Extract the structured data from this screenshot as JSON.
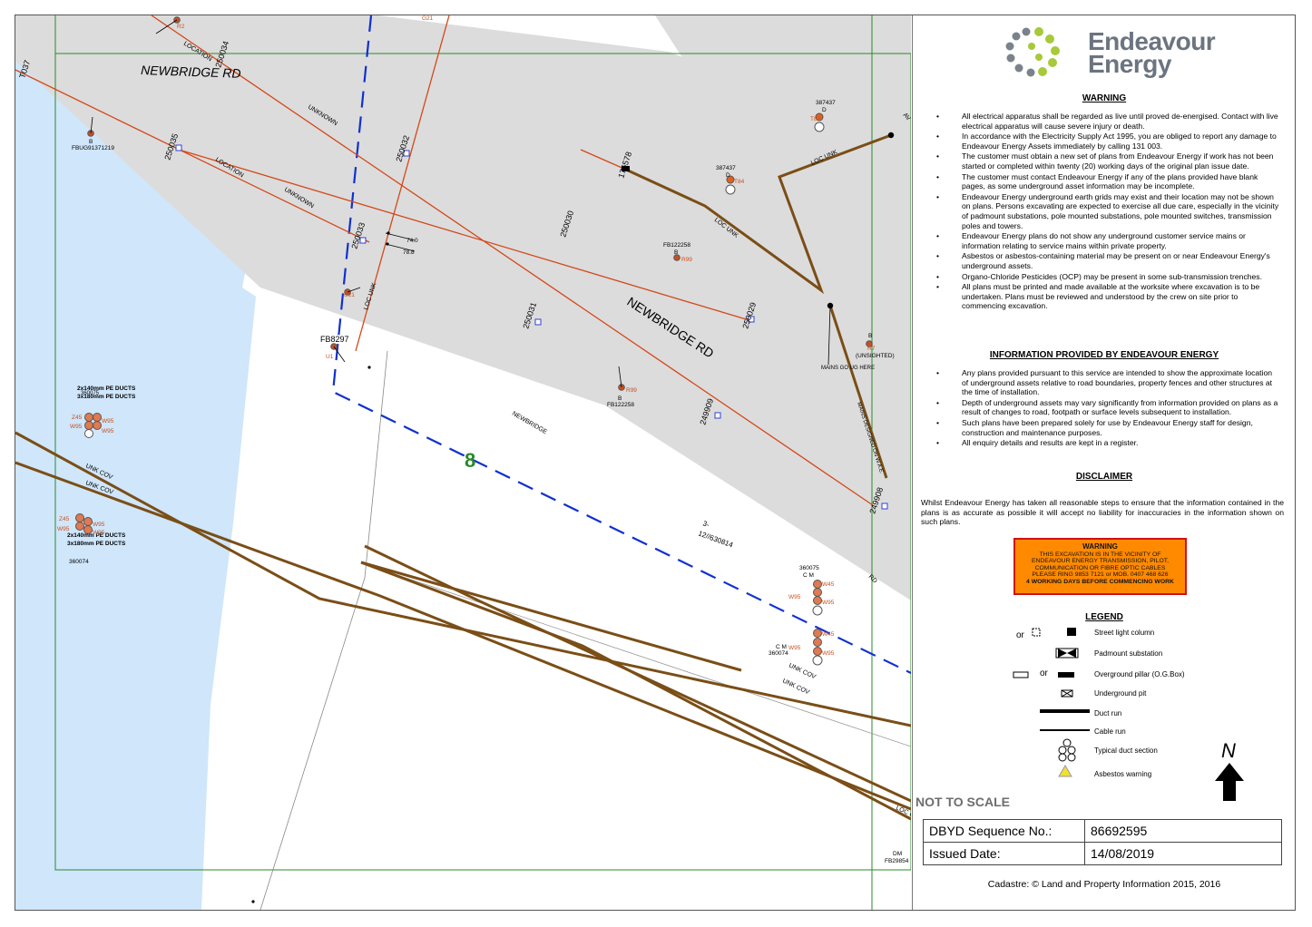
{
  "map": {
    "roads": {
      "road_top": "NEWBRIDGE RD",
      "road_main": "NEWBRIDGE RD",
      "road_lower": "NEWBRIDGE",
      "road_right": "AV",
      "road_rd": "RD"
    },
    "location_labels": {
      "loc1": "LOCATION",
      "loc2": "UNKNOWN",
      "loc3": "LOCATION",
      "loc4": "UNKNOWN",
      "loc5": "LOC UNK",
      "loc6": "LOC UNK",
      "loc7": "LOC UNK",
      "loc8": "MAINS DESIGNED ON W.A.E.",
      "loc9": "MAINS GO UG HERE",
      "loc10": "(UNSIGHTED)",
      "unk1": "UNK COV",
      "unk2": "UNK COV",
      "unk3": "UNK COV",
      "unk4": "UNK COV",
      "loc11": "LOC UNK"
    },
    "pole_numbers": [
      "250035",
      "250034",
      "250032",
      "250033",
      "250030",
      "176578",
      "250031",
      "250029",
      "249909",
      "249908",
      "T037"
    ],
    "asset_ids": {
      "fbug": "FBUG91371219",
      "fb122258a": "FB122258",
      "fb122258b": "FB122258",
      "fb8297": "FB8297",
      "a387437a": "387437",
      "a387437b": "387437",
      "a360075": "360075",
      "a360074a": "360074",
      "a360074b": "360074",
      "fb29854": "FB29854",
      "dm": "DM"
    },
    "pole_codes": [
      "R2",
      "G21",
      "T81",
      "T84",
      "R99",
      "R99",
      "U21",
      "U1",
      "R7",
      "B",
      "B",
      "D",
      "D",
      "B",
      "B"
    ],
    "duct_labels": {
      "d1": "2x140mm PE DUCTS",
      "d2": "3x180mm PE DUCTS",
      "d3": "2x140mm PE DUCTS",
      "d4": "3x180mm PE DUCTS",
      "d5": "360075"
    },
    "duct_codes": [
      "Z45",
      "W95",
      "W95",
      "W95",
      "Z45",
      "W95",
      "W95",
      "W95",
      "W45",
      "W95",
      "W95",
      "W45",
      "W95",
      "W95",
      "C M",
      "C M"
    ],
    "measurements": [
      "74.0",
      "78.8"
    ],
    "sheet_number": "8",
    "lot": "3-",
    "lot_dp": "12//630814",
    "colors": {
      "road": "#dcdcdc",
      "water": "#cfe6fb",
      "cable": "#d4481a",
      "duct": "#7a4e16",
      "boundary": "#2a8a2a",
      "dash": "#1030d0"
    }
  },
  "panel": {
    "logo_line1": "Endeavour",
    "logo_line2": "Energy",
    "warning_title": "WARNING",
    "warnings": [
      "All electrical apparatus shall be regarded as live until proved de-energised. Contact with live electrical apparatus will cause severe injury or death.",
      "In accordance with the Electricity Supply Act 1995, you are obliged to report any damage to Endeavour Energy Assets immediately by calling 131 003.",
      "The customer must obtain a new set of plans from Endeavour Energy if work has not been started or completed within twenty (20) working days of the original plan issue date.",
      "The customer must contact Endeavour Energy if any of the plans provided have blank pages, as some underground asset information may be incomplete.",
      "Endeavour Energy underground earth grids may exist and their location may not be shown on plans. Persons excavating are expected to exercise all due care, especially in the vicinity of padmount substations, pole mounted substations, pole mounted switches, transmission poles and towers.",
      "Endeavour Energy plans do not show any underground customer service mains or information relating to service mains within private property.",
      "Asbestos or asbestos-containing material may be present on or near Endeavour Energy's underground assets.",
      "Organo-Chloride Pesticides (OCP) may be present in some sub-transmission trenches.",
      "All plans must be printed and made available at the worksite where excavation is to be undertaken. Plans must be reviewed and understood by the crew on site prior to commencing excavation."
    ],
    "info_title": "INFORMATION PROVIDED BY ENDEAVOUR ENERGY",
    "info_items": [
      "Any plans provided pursuant to this service are intended to show the approximate location of underground assets relative to road boundaries, property fences and other structures at the time of installation.",
      "Depth of underground assets may vary significantly from information provided on plans as a result of changes to road, footpath or surface levels subsequent to installation.",
      "Such plans have been prepared solely for use by Endeavour Energy staff for design, construction and maintenance purposes.",
      "All enquiry details and results are kept in a register."
    ],
    "disclaimer_title": "DISCLAIMER",
    "disclaimer": "Whilst Endeavour Energy has taken all reasonable steps to ensure that the information contained in the plans is as accurate as possible it will accept no liability for inaccuracies in the information shown on such plans.",
    "warnbox": {
      "title": "WARNING",
      "line1": "THIS EXCAVATION IS IN THE VICINITY OF",
      "line2": "ENDEAVOUR ENERGY TRANSMISSION, PILOT,",
      "line3": "COMMUNICATION OR FIBRE OPTIC CABLES",
      "line4": "PLEASE RING 9853 7121 or MOB. 0407 468 626",
      "line5": "4 WORKING DAYS BEFORE COMMENCING WORK"
    },
    "legend_title": "LEGEND",
    "legend": {
      "or1": "or",
      "or2": "or",
      "street_light": "Street light column",
      "padmount": "Padmount substation",
      "pillar": "Overground pillar (O.G.Box)",
      "pit": "Underground pit",
      "duct_run": "Duct run",
      "cable_run": "Cable run",
      "duct_section": "Typical duct section",
      "asbestos": "Asbestos warning"
    },
    "north": "N",
    "not_to_scale": "NOT TO SCALE",
    "seq_label": "DBYD Sequence No.:",
    "seq_value": "86692595",
    "date_label": "Issued Date:",
    "date_value": "14/08/2019",
    "cadastre": "Cadastre: © Land and Property Information 2015, 2016"
  }
}
